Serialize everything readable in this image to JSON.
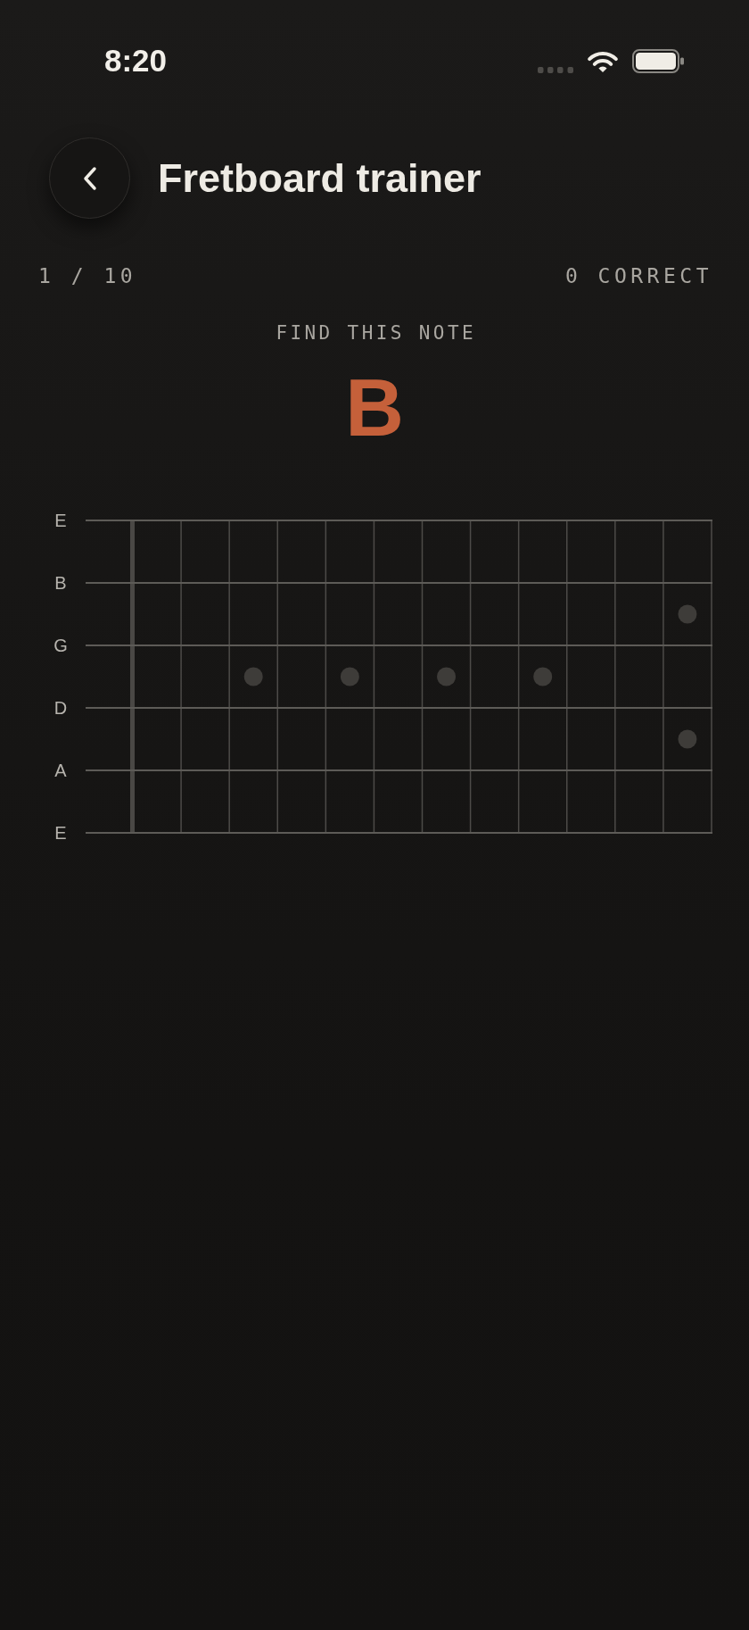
{
  "status_bar": {
    "time": "8:20"
  },
  "header": {
    "title": "Fretboard trainer"
  },
  "progress": {
    "question": "1 / 10",
    "score": "0 CORRECT"
  },
  "prompt": {
    "label": "FIND THIS NOTE",
    "note": "B"
  },
  "fretboard": {
    "strings": [
      {
        "label": "E"
      },
      {
        "label": "B"
      },
      {
        "label": "G"
      },
      {
        "label": "D"
      },
      {
        "label": "A"
      },
      {
        "label": "E"
      }
    ]
  }
}
